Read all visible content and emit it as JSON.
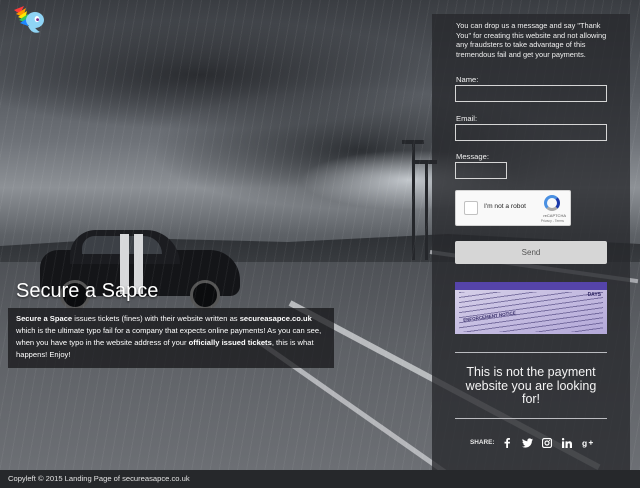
{
  "hero": {
    "title": "Secure a Sapce",
    "text_parts": [
      {
        "text": "Secure a Space",
        "bold": true
      },
      {
        "text": " issues tickets (fines) with their website written as ",
        "bold": false
      },
      {
        "text": "secureasapce.co.uk",
        "bold": true
      },
      {
        "text": " which is the ultimate typo fail for a company that expects online payments! As you can see, when you have typo in the website address of your ",
        "bold": false
      },
      {
        "text": "officially issued tickets",
        "bold": true
      },
      {
        "text": ", this is what happens! Enjoy!",
        "bold": false
      }
    ]
  },
  "form": {
    "intro": "You can drop us a message and say \"Thank You\" for creating this website and not allowing any fraudsters to take advantage of this tremendous fail and get your payments.",
    "name_label": "Name:",
    "email_label": "Email:",
    "message_label": "Message:",
    "recaptcha_label": "I'm not a robot",
    "recaptcha_brand": "reCAPTCHA",
    "recaptcha_terms": "Privacy - Terms",
    "send_label": "Send"
  },
  "ticket_image": {
    "days_text": "DAYS",
    "notice_text": "ENFORCEMENT NOTICE"
  },
  "tagline": "This is not the payment website you are looking for!",
  "share": {
    "label": "SHARE:",
    "icons": [
      "facebook-icon",
      "twitter-icon",
      "instagram-icon",
      "linkedin-icon",
      "google-plus-icon"
    ]
  },
  "footer": {
    "copyright": "Copyleft © 2015 Landing Page of secureasapce.co.uk"
  },
  "colors": {
    "panel_bg": "#26282c",
    "button_bg": "#d6d6d6",
    "footer_bg": "#26282b"
  }
}
